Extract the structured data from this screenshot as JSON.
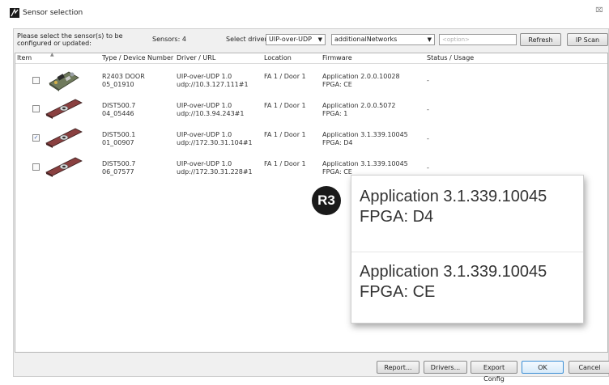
{
  "window": {
    "title": "Sensor selection",
    "close_glyph": "⌧"
  },
  "toolbar": {
    "instruction": "Please select the sensor(s) to be configured or updated:",
    "sensors_count": "Sensors: 4",
    "select_driver_label": "Select driver:",
    "driver_value": "UIP-over-UDP",
    "network_value": "additionalNetworks",
    "option_placeholder": "<option>",
    "refresh_label": "Refresh",
    "ipscan_label": "IP Scan"
  },
  "columns": {
    "item": "Item",
    "type": "Type / Device Number",
    "driver": "Driver / URL",
    "location": "Location",
    "firmware": "Firmware",
    "status": "Status / Usage"
  },
  "rows": [
    {
      "checked": false,
      "device_icon": "door-controller-board-icon",
      "type": "R2403 DOOR",
      "number": "05_01910",
      "driver": "UIP-over-UDP 1.0",
      "url": "udp://10.3.127.111#1",
      "location": "FA 1 / Door 1",
      "firmware": "Application 2.0.0.10028",
      "fpga": "FPGA: CE",
      "status": "-"
    },
    {
      "checked": false,
      "device_icon": "dist500-sensor-icon",
      "type": "DIST500.7",
      "number": "04_05446",
      "driver": "UIP-over-UDP 1.0",
      "url": "udp://10.3.94.243#1",
      "location": "FA 1 / Door 1",
      "firmware": "Application 2.0.0.5072",
      "fpga": "FPGA: 1",
      "status": "-"
    },
    {
      "checked": true,
      "device_icon": "dist500-sensor-icon",
      "type": "DIST500.1",
      "number": "01_00907",
      "driver": "UIP-over-UDP 1.0",
      "url": "udp://172.30.31.104#1",
      "location": "FA 1 / Door 1",
      "firmware": "Application 3.1.339.10045",
      "fpga": "FPGA: D4",
      "status": "-"
    },
    {
      "checked": false,
      "device_icon": "dist500-sensor-icon",
      "type": "DIST500.7",
      "number": "06_07577",
      "driver": "UIP-over-UDP 1.0",
      "url": "udp://172.30.31.228#1",
      "location": "FA 1 / Door 1",
      "firmware": "Application 3.1.339.10045",
      "fpga": "FPGA: CE",
      "status": "-"
    }
  ],
  "footer": {
    "report_label": "Report...",
    "drivers_label": "Drivers...",
    "export_label": "Export Config",
    "ok_label": "OK",
    "cancel_label": "Cancel"
  },
  "callout": {
    "badge": "R3",
    "entries": [
      {
        "firmware": "Application 3.1.339.10045",
        "fpga": "FPGA: D4"
      },
      {
        "firmware": "Application 3.1.339.10045",
        "fpga": "FPGA: CE"
      }
    ]
  },
  "colors": {
    "ok_border": "#3b8fd6",
    "checkmark": "#3b5fb0",
    "sensor_body": "#7a3a3a"
  }
}
